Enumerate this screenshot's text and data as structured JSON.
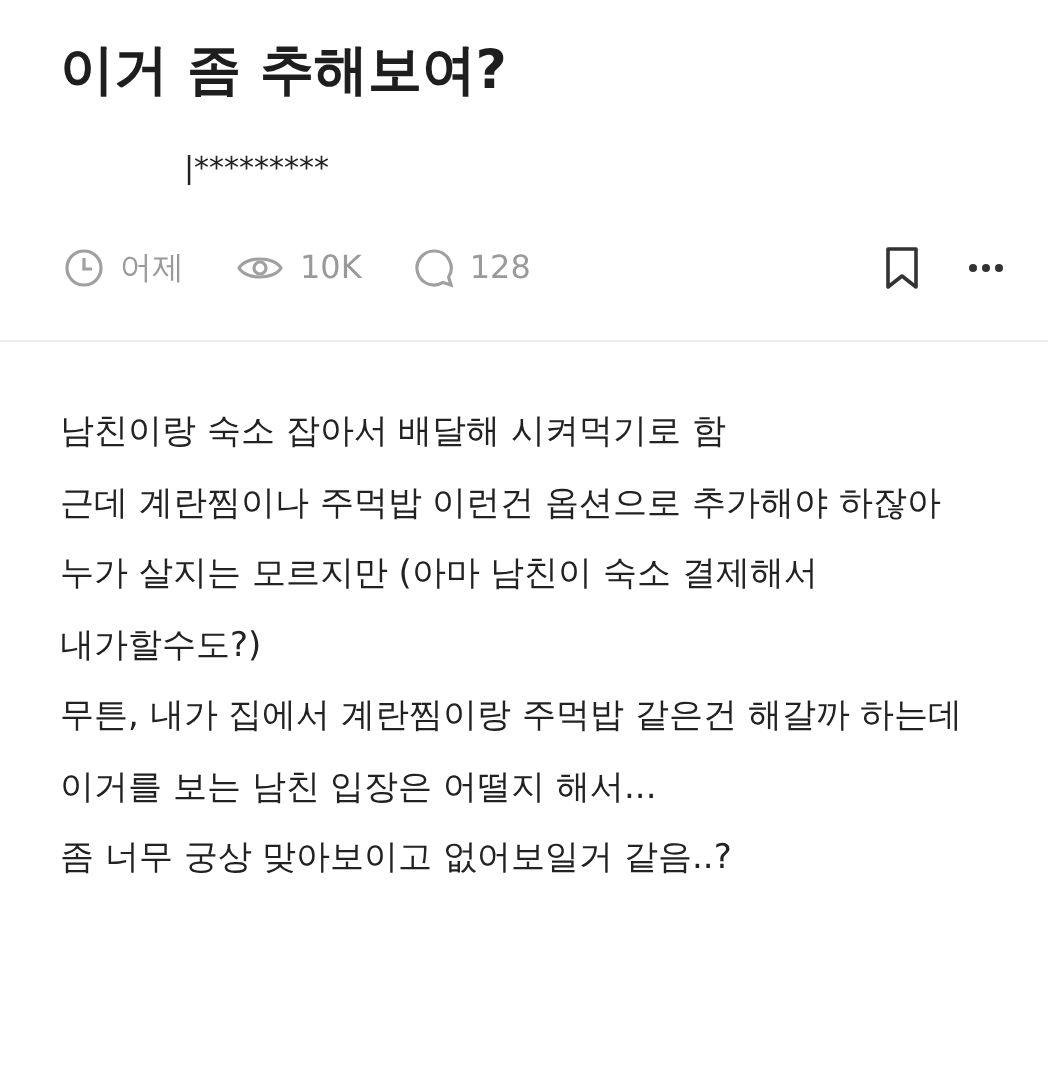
{
  "post": {
    "title": "이거 좀 추해보여?",
    "author": "|*********",
    "meta": [
      {
        "kind": "time",
        "text": "어제"
      },
      {
        "kind": "views",
        "text": "10K"
      },
      {
        "kind": "comments",
        "text": "128"
      }
    ],
    "bookmarked": false,
    "body": [
      "남친이랑 숙소 잡아서 배달해 시켜먹기로 함",
      "근데 계란찜이나 주먹밥 이런건 옵션으로 추가해야 하잖아",
      "누가 살지는 모르지만 (아마 남친이 숙소 결제해서 내가할수도?)",
      "무튼, 내가 집에서 계란찜이랑 주먹밥 같은건 해갈까 하는데",
      "이거를 보는 남친 입장은 어떨지 해서...",
      "좀 너무 궁상 맞아보이고 없어보일거 같음..?"
    ]
  }
}
